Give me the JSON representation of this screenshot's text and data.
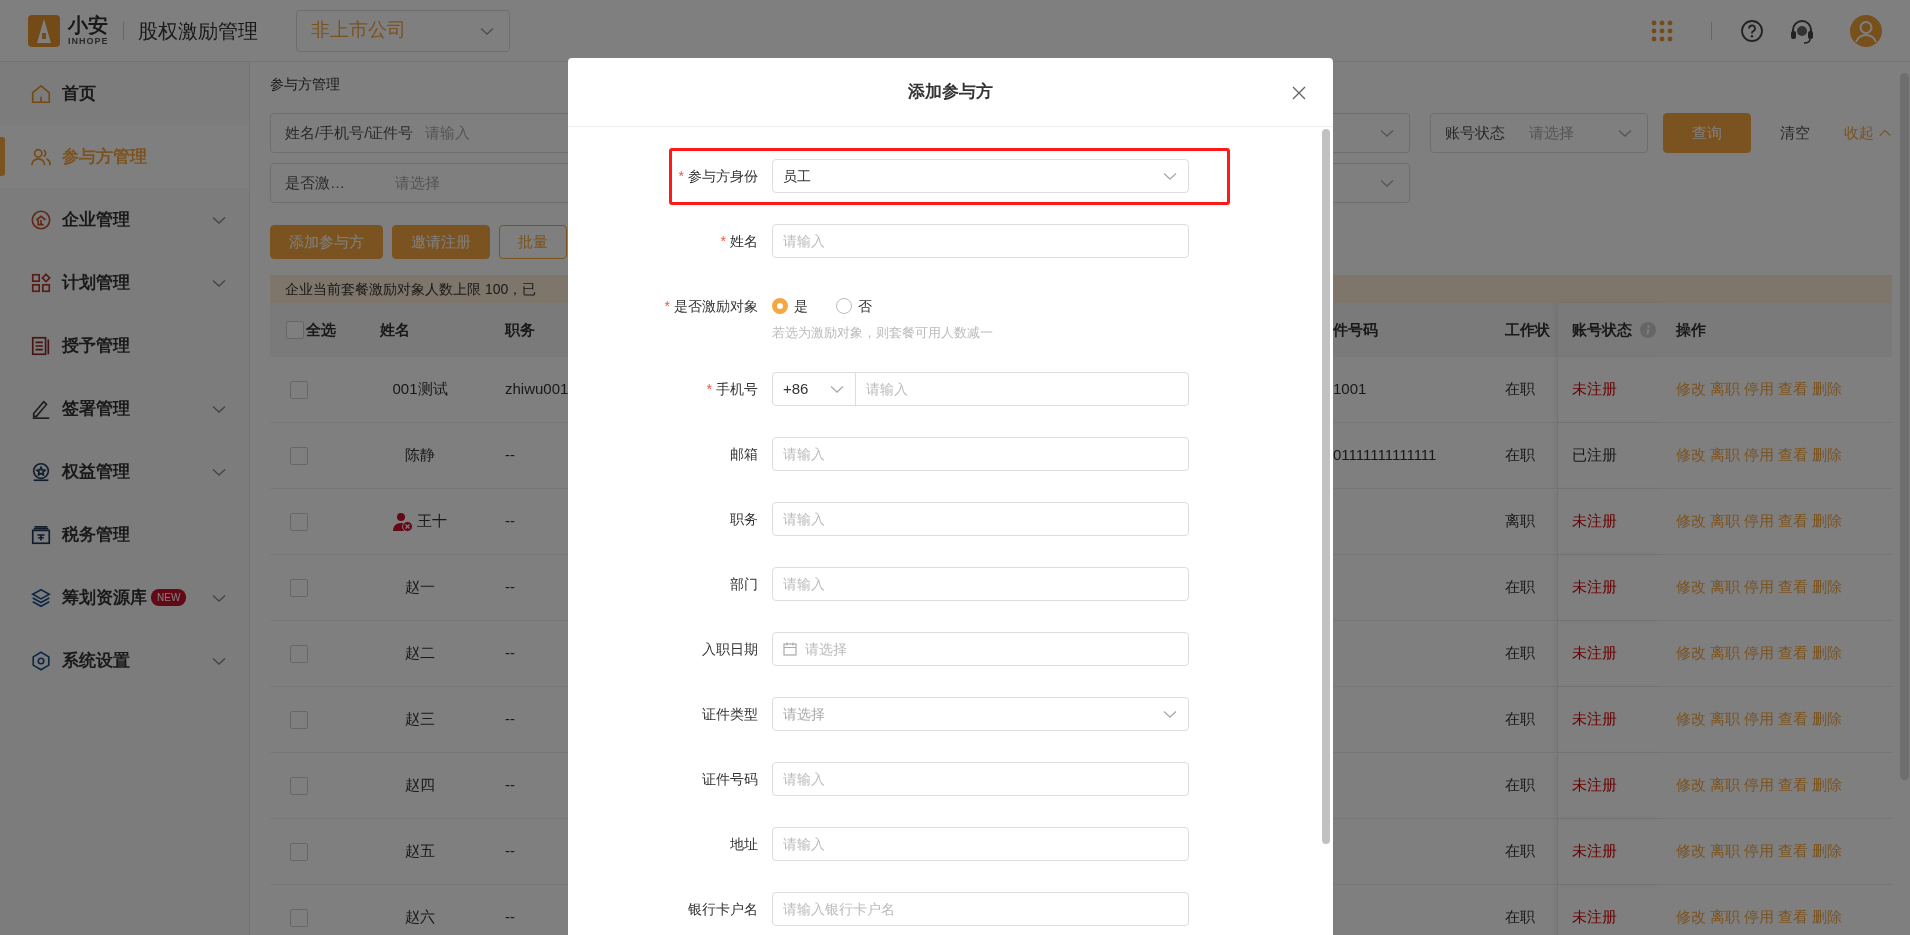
{
  "header": {
    "logo_text": "小安",
    "logo_subtext": "INHOPE",
    "app_title": "股权激励管理",
    "company_type": "非上市公司"
  },
  "sidebar": {
    "items": [
      {
        "label": "首页",
        "selected": false,
        "has_submenu": false
      },
      {
        "label": "参与方管理",
        "selected": true,
        "has_submenu": false
      },
      {
        "label": "企业管理",
        "selected": false,
        "has_submenu": true
      },
      {
        "label": "计划管理",
        "selected": false,
        "has_submenu": true
      },
      {
        "label": "授予管理",
        "selected": false,
        "has_submenu": false
      },
      {
        "label": "签署管理",
        "selected": false,
        "has_submenu": true
      },
      {
        "label": "权益管理",
        "selected": false,
        "has_submenu": true
      },
      {
        "label": "税务管理",
        "selected": false,
        "has_submenu": false
      },
      {
        "label": "筹划资源库",
        "selected": false,
        "has_submenu": true,
        "badge": "NEW"
      },
      {
        "label": "系统设置",
        "selected": false,
        "has_submenu": true
      }
    ]
  },
  "breadcrumb": "参与方管理",
  "filters": {
    "keyword": {
      "label": "姓名/手机号/证件号",
      "placeholder": "请输入"
    },
    "incentive": {
      "label": "是否激…",
      "placeholder": "请选择"
    },
    "account_status": {
      "label": "账号状态",
      "placeholder": "请选择"
    },
    "query_button": "查询",
    "clear_button": "清空",
    "collapse_link": "收起"
  },
  "toolbar": [
    "添加参与方",
    "邀请注册",
    "批量"
  ],
  "notice": "企业当前套餐激励对象人数上限 100，已",
  "table": {
    "columns": [
      {
        "label": "全选",
        "checked": false
      },
      {
        "label": "姓名"
      },
      {
        "label": "职务"
      },
      {
        "label": "件号码"
      },
      {
        "label": "工作状"
      },
      {
        "label": "账号状态",
        "info": true
      },
      {
        "label": "操作"
      }
    ],
    "rows": [
      {
        "checked": false,
        "flagged": false,
        "name": "001测试",
        "position": "zhiwu001",
        "id_number": "1001",
        "work_status": "在职",
        "account_status": "未注册",
        "registered": false,
        "actions": [
          "修改",
          "离职",
          "停用",
          "查看",
          "删除"
        ]
      },
      {
        "checked": false,
        "flagged": false,
        "name": "陈静",
        "position": "--",
        "id_number": "01111111111111",
        "work_status": "在职",
        "account_status": "已注册",
        "registered": true,
        "actions": [
          "修改",
          "离职",
          "停用",
          "查看",
          "删除"
        ]
      },
      {
        "checked": false,
        "flagged": true,
        "name": "王十",
        "position": "--",
        "work_status": "离职",
        "account_status": "未注册",
        "registered": false,
        "actions": [
          "修改",
          "离职",
          "停用",
          "查看",
          "删除"
        ]
      },
      {
        "checked": false,
        "flagged": false,
        "name": "赵一",
        "position": "--",
        "work_status": "在职",
        "account_status": "未注册",
        "registered": false,
        "actions": [
          "修改",
          "离职",
          "停用",
          "查看",
          "删除"
        ]
      },
      {
        "checked": false,
        "flagged": false,
        "name": "赵二",
        "position": "--",
        "work_status": "在职",
        "account_status": "未注册",
        "registered": false,
        "actions": [
          "修改",
          "离职",
          "停用",
          "查看",
          "删除"
        ]
      },
      {
        "checked": false,
        "flagged": false,
        "name": "赵三",
        "position": "--",
        "work_status": "在职",
        "account_status": "未注册",
        "registered": false,
        "actions": [
          "修改",
          "离职",
          "停用",
          "查看",
          "删除"
        ]
      },
      {
        "checked": false,
        "flagged": false,
        "name": "赵四",
        "position": "--",
        "work_status": "在职",
        "account_status": "未注册",
        "registered": false,
        "actions": [
          "修改",
          "离职",
          "停用",
          "查看",
          "删除"
        ]
      },
      {
        "checked": false,
        "flagged": false,
        "name": "赵五",
        "position": "--",
        "work_status": "在职",
        "account_status": "未注册",
        "registered": false,
        "actions": [
          "修改",
          "离职",
          "停用",
          "查看",
          "删除"
        ]
      },
      {
        "checked": false,
        "flagged": false,
        "name": "赵六",
        "position": "--",
        "work_status": "在职",
        "account_status": "未注册",
        "registered": false,
        "actions": [
          "修改",
          "离职",
          "停用",
          "查看",
          "删除"
        ]
      }
    ]
  },
  "modal": {
    "title": "添加参与方",
    "fields": [
      {
        "kind": "select",
        "label": "参与方身份",
        "required_mark": "*",
        "highlighted": true,
        "value": "员工"
      },
      {
        "kind": "input",
        "label": "姓名",
        "required_mark": "*",
        "placeholder": "请输入"
      },
      {
        "kind": "radio",
        "label": "是否激励对象",
        "required_mark": "*",
        "options": [
          {
            "label": "是",
            "selected": true
          },
          {
            "label": "否",
            "selected": false
          }
        ],
        "hint": "若选为激励对象，则套餐可用人数减一"
      },
      {
        "kind": "phone",
        "label": "手机号",
        "required_mark": "*",
        "code": "+86",
        "placeholder": "请输入"
      },
      {
        "kind": "input",
        "label": "邮箱",
        "placeholder": "请输入"
      },
      {
        "kind": "input",
        "label": "职务",
        "placeholder": "请输入"
      },
      {
        "kind": "input",
        "label": "部门",
        "placeholder": "请输入"
      },
      {
        "kind": "date",
        "label": "入职日期",
        "placeholder": "请选择"
      },
      {
        "kind": "select",
        "label": "证件类型",
        "placeholder": "请选择"
      },
      {
        "kind": "input",
        "label": "证件号码",
        "placeholder": "请输入"
      },
      {
        "kind": "input",
        "label": "地址",
        "placeholder": "请输入"
      },
      {
        "kind": "input",
        "label": "银行卡户名",
        "placeholder": "请输入银行卡户名"
      }
    ]
  }
}
